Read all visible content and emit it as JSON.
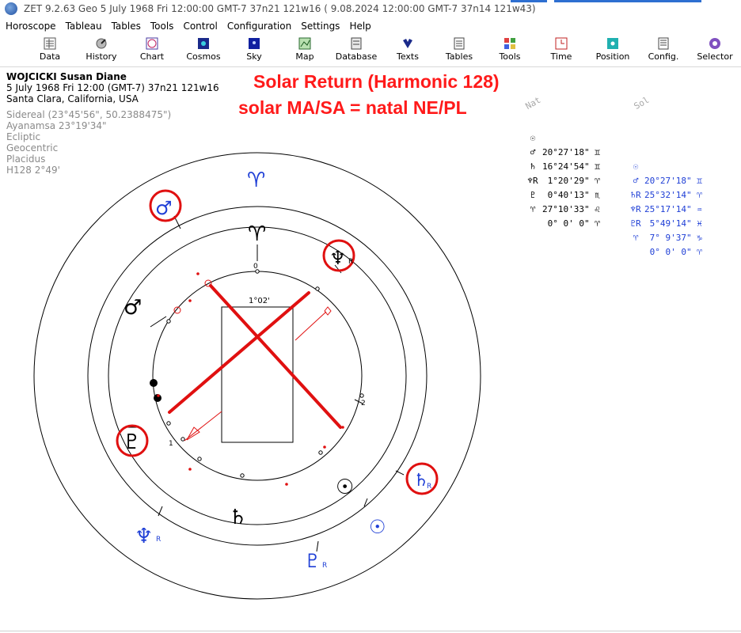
{
  "window": {
    "title": "ZET 9.2.63 Geo   5 July 1968  Fri  12:00:00 GMT-7 37n21  121w16  ( 9.08.2024  12:00:00 GMT-7 37n14 121w43)"
  },
  "menu": [
    "Horoscope",
    "Tableau",
    "Tables",
    "Tools",
    "Control",
    "Configuration",
    "Settings",
    "Help"
  ],
  "toolbar": [
    {
      "label": "Data",
      "icon": "data-icon"
    },
    {
      "label": "History",
      "icon": "history-icon"
    },
    {
      "label": "Chart",
      "icon": "chart-icon"
    },
    {
      "label": "Cosmos",
      "icon": "cosmos-icon"
    },
    {
      "label": "Sky",
      "icon": "sky-icon"
    },
    {
      "label": "Map",
      "icon": "map-icon"
    },
    {
      "label": "Database",
      "icon": "database-icon"
    },
    {
      "label": "Texts",
      "icon": "texts-icon"
    },
    {
      "label": "Tables",
      "icon": "tables-icon"
    },
    {
      "label": "Tools",
      "icon": "tools-icon"
    },
    {
      "label": "Time",
      "icon": "time-icon"
    },
    {
      "label": "Position",
      "icon": "position-icon"
    },
    {
      "label": "Config.",
      "icon": "config-icon"
    },
    {
      "label": "Selector",
      "icon": "selector-icon"
    }
  ],
  "chart_info": {
    "name": "WOJCICKI Susan Diane",
    "datetime": "5 July 1968  Fri  12:00 (GMT-7) 37n21  121w16",
    "place": "Santa Clara, California, USA",
    "settings": [
      "Sidereal (23°45'56\", 50.2388475\")",
      "Ayanamsa 23°19'34\"",
      "Ecliptic",
      "Geocentric",
      "Placidus",
      "H128   2°49'"
    ]
  },
  "annotation": {
    "title": "Solar Return (Harmonic 128)",
    "subtitle": "solar MA/SA = natal NE/PL",
    "color": "#ff1a1a"
  },
  "positions": {
    "nat_header": "Nat",
    "sol_header": "Sol",
    "rows": [
      {
        "nat_sym": "☉",
        "nat_val": "20°27'18\" ♊",
        "sol_sym": "☉",
        "sol_val": "20°27'18\" ♊"
      },
      {
        "nat_sym": "♂",
        "nat_val": "16°24'54\" ♊",
        "sol_sym": "♂",
        "sol_val": "25°32'14\" ♈"
      },
      {
        "nat_sym": "♄",
        "nat_val": " 1°20'29\" ♈",
        "sol_sym": "♄R",
        "sol_val": "25°17'14\" ♒"
      },
      {
        "nat_sym": "♆R",
        "nat_val": " 0°40'13\" ♏",
        "sol_sym": "♆R",
        "sol_val": " 5°49'14\" ♓"
      },
      {
        "nat_sym": "♇",
        "nat_val": "27°10'33\" ♌",
        "sol_sym": "♇R",
        "sol_val": " 7° 9'37\" ♑"
      },
      {
        "nat_sym": "♈",
        "nat_val": " 0° 0' 0\" ♈",
        "sol_sym": "♈",
        "sol_val": " 0° 0' 0\" ♈"
      }
    ]
  },
  "wheel": {
    "inner_rect_label": "1°02'",
    "cusp_labels": [
      "0",
      "2",
      "1"
    ],
    "natal_glyphs": [
      "♈",
      "♂",
      "♆",
      "♇",
      "☉",
      "♄"
    ],
    "natal_retro": [
      "R"
    ],
    "solar_glyphs": [
      "♈",
      "♂",
      "♄",
      "☉",
      "♆",
      "♇"
    ],
    "solar_retro": [
      "R",
      "R",
      "R"
    ],
    "natal_color": "#000000",
    "solar_color": "#1f3fd6",
    "highlight_color": "#e01010"
  }
}
